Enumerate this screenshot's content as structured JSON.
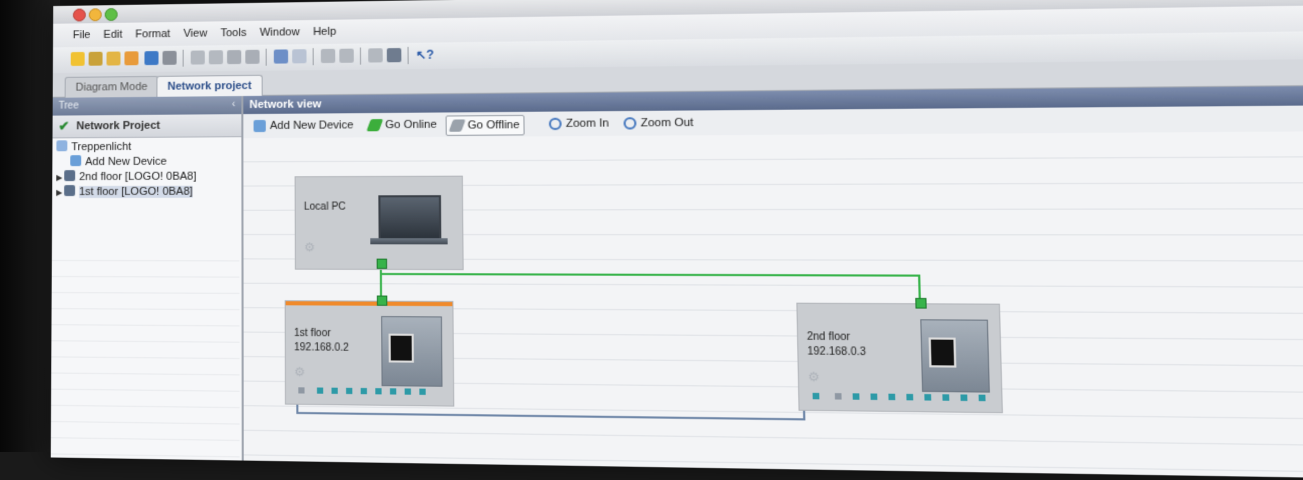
{
  "window": {
    "menu": [
      "File",
      "Edit",
      "Format",
      "View",
      "Tools",
      "Window",
      "Help"
    ]
  },
  "tabs": {
    "diagram_mode": "Diagram Mode",
    "network_project": "Network project"
  },
  "tree": {
    "header": "Tree",
    "collapse_glyph": "‹",
    "project": "Network Project",
    "root": "Treppenlicht",
    "items": [
      {
        "label": "Add New Device",
        "icon": "add-device-icon"
      },
      {
        "label": "2nd floor [LOGO! 0BA8]",
        "icon": "plc-icon"
      },
      {
        "label": "1st floor [LOGO! 0BA8]",
        "icon": "plc-icon"
      }
    ]
  },
  "network_view": {
    "title": "Network view",
    "toolbar": {
      "add_device": "Add New Device",
      "go_online": "Go Online",
      "go_offline": "Go Offline",
      "zoom_in": "Zoom In",
      "zoom_out": "Zoom Out"
    },
    "devices": {
      "pc": {
        "name": "Local PC"
      },
      "first_floor": {
        "name": "1st floor",
        "ip": "192.168.0.2"
      },
      "second_floor": {
        "name": "2nd floor",
        "ip": "192.168.0.3"
      }
    }
  },
  "colors": {
    "ethernet_link": "#37b34a",
    "io_link": "#6f87a8",
    "selected_accent": "#f08a2b",
    "header_blue": "#5b6b8c"
  }
}
